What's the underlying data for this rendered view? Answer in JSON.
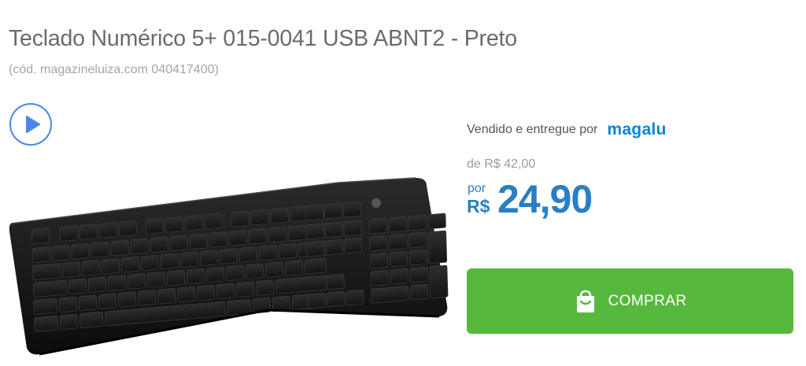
{
  "product": {
    "title": "Teclado Numérico 5+ 015-0041 USB ABNT2 - Preto",
    "code": "(cód. magazineluiza.com 040417400)"
  },
  "seller": {
    "label": "Vendido e entregue por",
    "logo_text": "magalu"
  },
  "pricing": {
    "old_price": "de R$ 42,00",
    "por_label": "por",
    "currency": "R$",
    "price": "24,90"
  },
  "buy_button": {
    "label": "COMPRAR",
    "icon": "shopping-bag-icon"
  },
  "media": {
    "play_icon": "play-icon",
    "image": "keyboard-product-image"
  },
  "colors": {
    "price_blue": "#2a7fc4",
    "buy_green": "#57b83e",
    "logo_blue": "#0a84d8",
    "play_blue": "#4a86e8"
  }
}
